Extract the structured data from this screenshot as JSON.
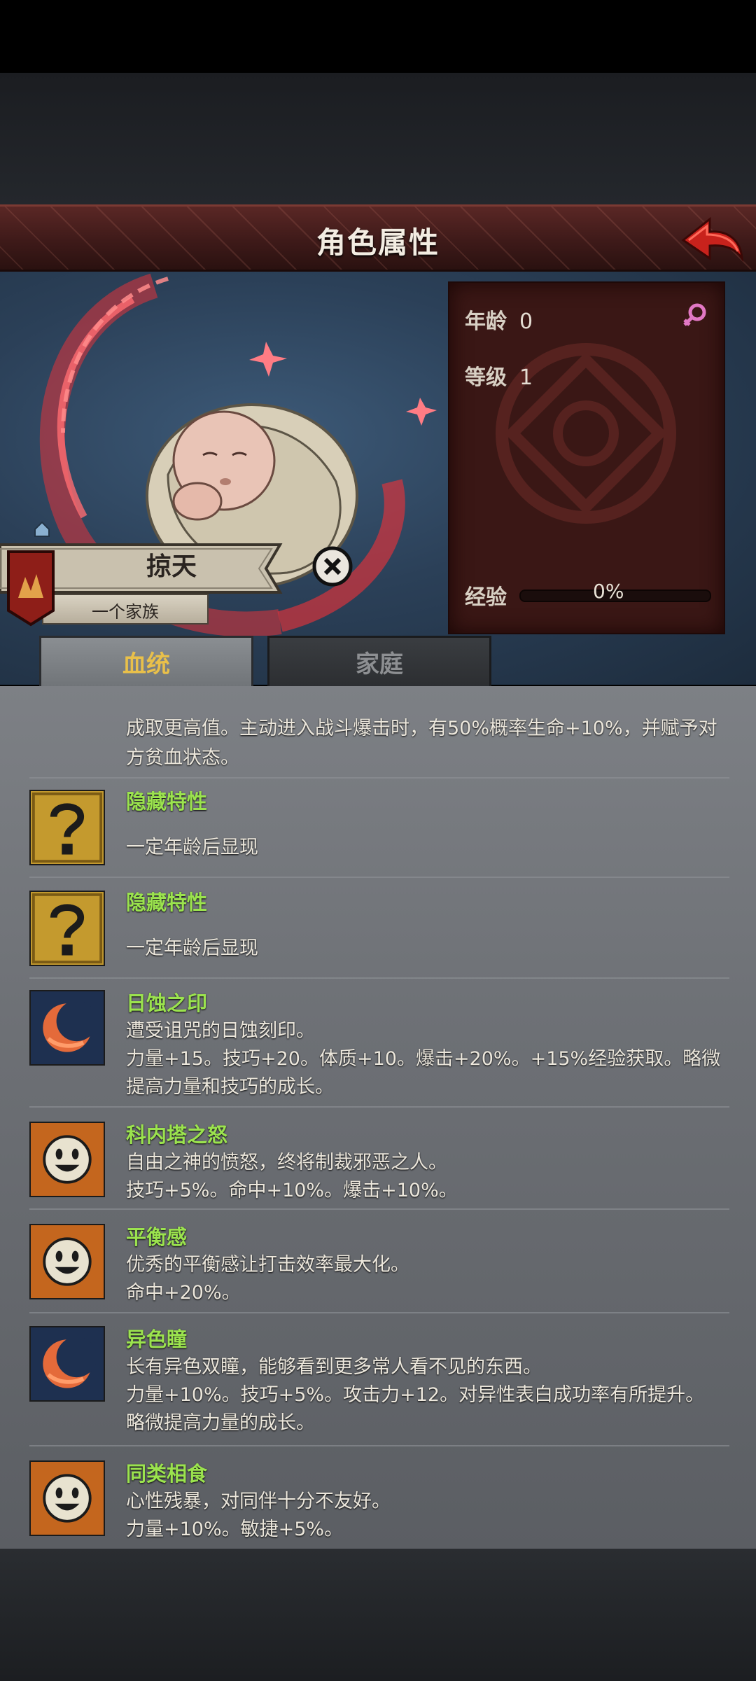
{
  "header": {
    "title": "角色属性",
    "back_icon": "back-arrow-icon"
  },
  "character": {
    "name": "掠天",
    "family": "一个家族",
    "age_label": "年龄",
    "age_value": "0",
    "level_label": "等级",
    "level_value": "1",
    "exp_label": "经验",
    "exp_value": "0%",
    "exp_fraction": 0,
    "gender_icon": "female-icon"
  },
  "tabs": [
    {
      "label": "血统",
      "active": true
    },
    {
      "label": "家庭",
      "active": false
    }
  ],
  "traits": [
    {
      "name": "",
      "icon": "cut-off",
      "lines": [
        "成取更高值。主动进入战斗爆击时，有50%概率生命+10%，并赋予对",
        "方贫血状态。"
      ]
    },
    {
      "name": "隐藏特性",
      "icon": "question-icon",
      "lines": [
        "",
        "一定年龄后显现"
      ]
    },
    {
      "name": "隐藏特性",
      "icon": "question-icon",
      "lines": [
        "",
        "一定年龄后显现"
      ]
    },
    {
      "name": "日蚀之印",
      "icon": "eclipse-icon",
      "lines": [
        "遭受诅咒的日蚀刻印。",
        "力量+15。技巧+20。体质+10。爆击+20%。+15%经验获取。略微",
        "提高力量和技巧的成长。"
      ]
    },
    {
      "name": "科内塔之怒",
      "icon": "smile-face-icon",
      "lines": [
        "自由之神的愤怒，终将制裁邪恶之人。",
        "技巧+5%。命中+10%。爆击+10%。"
      ]
    },
    {
      "name": "平衡感",
      "icon": "smile-face-icon",
      "lines": [
        "优秀的平衡感让打击效率最大化。",
        "命中+20%。"
      ]
    },
    {
      "name": "异色瞳",
      "icon": "eclipse-icon",
      "lines": [
        "长有异色双瞳，能够看到更多常人看不见的东西。",
        "力量+10%。技巧+5%。攻击力+12。对异性表白成功率有所提升。",
        "略微提高力量的成长。"
      ]
    },
    {
      "name": "同类相食",
      "icon": "smile-face-icon",
      "lines": [
        "心性残暴，对同伴十分不友好。",
        "力量+10%。敏捷+5%。"
      ]
    }
  ]
}
